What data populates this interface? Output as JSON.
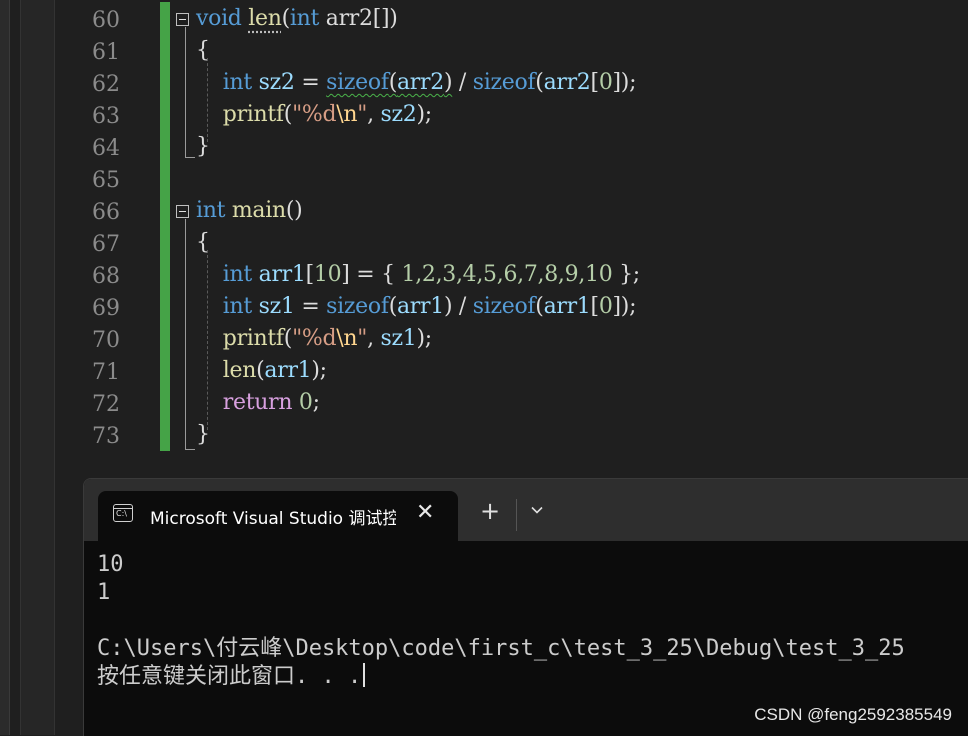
{
  "editor": {
    "line_numbers": [
      "60",
      "61",
      "62",
      "63",
      "64",
      "65",
      "66",
      "67",
      "68",
      "69",
      "70",
      "71",
      "72",
      "73"
    ],
    "lines": [
      [
        {
          "t": "void",
          "c": "kw"
        },
        {
          "t": " ",
          "c": "p"
        },
        {
          "t": "len",
          "c": "fn dots"
        },
        {
          "t": "(",
          "c": "p"
        },
        {
          "t": "int",
          "c": "kw"
        },
        {
          "t": " arr2[])",
          "c": "p"
        }
      ],
      [
        {
          "t": "{",
          "c": "p"
        }
      ],
      [
        {
          "t": "    ",
          "c": "p"
        },
        {
          "t": "int",
          "c": "kw"
        },
        {
          "t": " ",
          "c": "p"
        },
        {
          "t": "sz2",
          "c": "var"
        },
        {
          "t": " = ",
          "c": "p"
        },
        {
          "t": "sizeof",
          "c": "kw squig"
        },
        {
          "t": "(",
          "c": "p squig"
        },
        {
          "t": "arr2",
          "c": "var squig"
        },
        {
          "t": ")",
          "c": "p squig"
        },
        {
          "t": " / ",
          "c": "p"
        },
        {
          "t": "sizeof",
          "c": "kw"
        },
        {
          "t": "(",
          "c": "p"
        },
        {
          "t": "arr2",
          "c": "var"
        },
        {
          "t": "[",
          "c": "p"
        },
        {
          "t": "0",
          "c": "num"
        },
        {
          "t": "]);",
          "c": "p"
        }
      ],
      [
        {
          "t": "    ",
          "c": "p"
        },
        {
          "t": "printf",
          "c": "fn"
        },
        {
          "t": "(",
          "c": "p"
        },
        {
          "t": "\"%d",
          "c": "str"
        },
        {
          "t": "\\n",
          "c": "esc"
        },
        {
          "t": "\"",
          "c": "str"
        },
        {
          "t": ", ",
          "c": "p"
        },
        {
          "t": "sz2",
          "c": "var"
        },
        {
          "t": ");",
          "c": "p"
        }
      ],
      [
        {
          "t": "}",
          "c": "p"
        }
      ],
      [],
      [
        {
          "t": "int",
          "c": "kw"
        },
        {
          "t": " ",
          "c": "p"
        },
        {
          "t": "main",
          "c": "fn"
        },
        {
          "t": "()",
          "c": "p"
        }
      ],
      [
        {
          "t": "{",
          "c": "p"
        }
      ],
      [
        {
          "t": "    ",
          "c": "p"
        },
        {
          "t": "int",
          "c": "kw"
        },
        {
          "t": " ",
          "c": "p"
        },
        {
          "t": "arr1",
          "c": "var"
        },
        {
          "t": "[",
          "c": "p"
        },
        {
          "t": "10",
          "c": "num"
        },
        {
          "t": "] = { ",
          "c": "p"
        },
        {
          "t": "1,2,3,4,5,6,7,8,9,10",
          "c": "num"
        },
        {
          "t": " };",
          "c": "p"
        }
      ],
      [
        {
          "t": "    ",
          "c": "p"
        },
        {
          "t": "int",
          "c": "kw"
        },
        {
          "t": " ",
          "c": "p"
        },
        {
          "t": "sz1",
          "c": "var"
        },
        {
          "t": " = ",
          "c": "p"
        },
        {
          "t": "sizeof",
          "c": "kw"
        },
        {
          "t": "(",
          "c": "p"
        },
        {
          "t": "arr1",
          "c": "var"
        },
        {
          "t": ") / ",
          "c": "p"
        },
        {
          "t": "sizeof",
          "c": "kw"
        },
        {
          "t": "(",
          "c": "p"
        },
        {
          "t": "arr1",
          "c": "var"
        },
        {
          "t": "[",
          "c": "p"
        },
        {
          "t": "0",
          "c": "num"
        },
        {
          "t": "]);",
          "c": "p"
        }
      ],
      [
        {
          "t": "    ",
          "c": "p"
        },
        {
          "t": "printf",
          "c": "fn"
        },
        {
          "t": "(",
          "c": "p"
        },
        {
          "t": "\"%d",
          "c": "str"
        },
        {
          "t": "\\n",
          "c": "esc"
        },
        {
          "t": "\"",
          "c": "str"
        },
        {
          "t": ", ",
          "c": "p"
        },
        {
          "t": "sz1",
          "c": "var"
        },
        {
          "t": ");",
          "c": "p"
        }
      ],
      [
        {
          "t": "    ",
          "c": "p"
        },
        {
          "t": "len",
          "c": "fn"
        },
        {
          "t": "(",
          "c": "p"
        },
        {
          "t": "arr1",
          "c": "var"
        },
        {
          "t": ");",
          "c": "p"
        }
      ],
      [
        {
          "t": "    ",
          "c": "p"
        },
        {
          "t": "return",
          "c": "kw2"
        },
        {
          "t": " ",
          "c": "p"
        },
        {
          "t": "0",
          "c": "num"
        },
        {
          "t": ";",
          "c": "p"
        }
      ],
      [
        {
          "t": "}",
          "c": "p"
        }
      ]
    ],
    "colors": {
      "keyword": "#569cd6",
      "function": "#dcdcaa",
      "variable": "#9cdcfe",
      "number": "#b5cea8",
      "string": "#d69d85",
      "control": "#d8a0df",
      "change_bar": "#45a347"
    }
  },
  "terminal": {
    "tab_icon_label": "C:\\",
    "tab_title": "Microsoft Visual Studio 调试控制台",
    "close_icon": "close-icon",
    "add_icon": "plus-icon",
    "dropdown_icon": "chevron-down-icon",
    "output_lines": [
      "10",
      "1",
      "",
      "C:\\Users\\付云峰\\Desktop\\code\\first_c\\test_3_25\\Debug\\test_3_25",
      "按任意键关闭此窗口. . ."
    ]
  },
  "watermark": "CSDN @feng2592385549"
}
